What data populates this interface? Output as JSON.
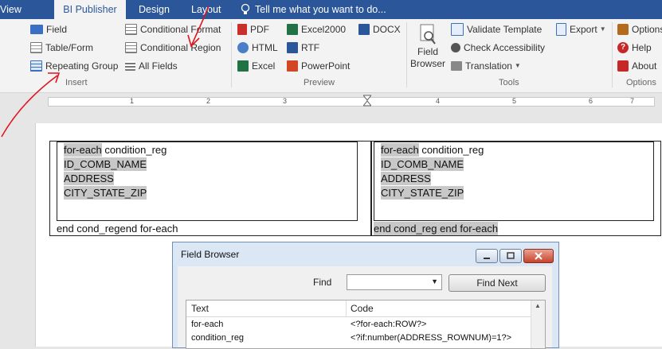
{
  "tabs": [
    {
      "label": "View",
      "active": false
    },
    {
      "label": "BI Publisher",
      "active": true
    },
    {
      "label": "Design",
      "active": false
    },
    {
      "label": "Layout",
      "active": false
    }
  ],
  "tell_me": "Tell me what you want to do...",
  "ribbon": {
    "insert": {
      "group_label": "Insert",
      "items": [
        "Field",
        "Table/Form",
        "Repeating Group",
        "Conditional Format",
        "Conditional Region",
        "All Fields"
      ]
    },
    "preview": {
      "group_label": "Preview",
      "items": [
        "PDF",
        "HTML",
        "Excel",
        "Excel2000",
        "RTF",
        "PowerPoint",
        "DOCX"
      ]
    },
    "tools": {
      "group_label": "Tools",
      "field_browser_line1": "Field",
      "field_browser_line2": "Browser",
      "validate": "Validate Template",
      "accessibility": "Check Accessibility",
      "translation": "Translation",
      "export": "Export"
    },
    "options": {
      "group_label": "Options",
      "items": [
        "Options",
        "Help",
        "About"
      ]
    }
  },
  "ruler": {
    "numbers": [
      "1",
      "2",
      "3",
      "4",
      "5",
      "6",
      "7"
    ]
  },
  "document": {
    "cells": [
      {
        "lines": [
          [
            {
              "text": "for-each",
              "field": true
            },
            {
              "text": " condition_reg",
              "field": false
            }
          ],
          [
            {
              "text": "ID_COMB_NAME",
              "field": true
            }
          ],
          [
            {
              "text": "ADDRESS",
              "field": true
            }
          ],
          [
            {
              "text": "CITY_STATE_ZIP",
              "field": true
            }
          ]
        ],
        "footer": [
          {
            "text": "end cond_regend for-each",
            "field": true
          }
        ]
      },
      {
        "lines": [
          [
            {
              "text": "for-each",
              "field": true
            },
            {
              "text": " condition_reg",
              "field": false
            }
          ],
          [
            {
              "text": "ID_COMB_NAME",
              "field": true
            }
          ],
          [
            {
              "text": "ADDRESS",
              "field": true
            }
          ],
          [
            {
              "text": "CITY_STATE_ZIP",
              "field": true
            }
          ]
        ],
        "footer": [
          {
            "text": "end cond_reg end for-each",
            "field": true
          }
        ]
      }
    ]
  },
  "field_browser": {
    "title": "Field Browser",
    "find_label": "Find",
    "find_value": "",
    "find_next": "Find Next",
    "columns": [
      "Text",
      "Code"
    ],
    "rows": [
      {
        "text": "for-each",
        "code": "<?for-each:ROW?>"
      },
      {
        "text": "condition_reg",
        "code": "<?if:number(ADDRESS_ROWNUM)=1?>"
      }
    ]
  },
  "colors": {
    "tabbar": "#2b579a",
    "field_shading": "#c8c8c8",
    "annotation": "#e0141e"
  }
}
